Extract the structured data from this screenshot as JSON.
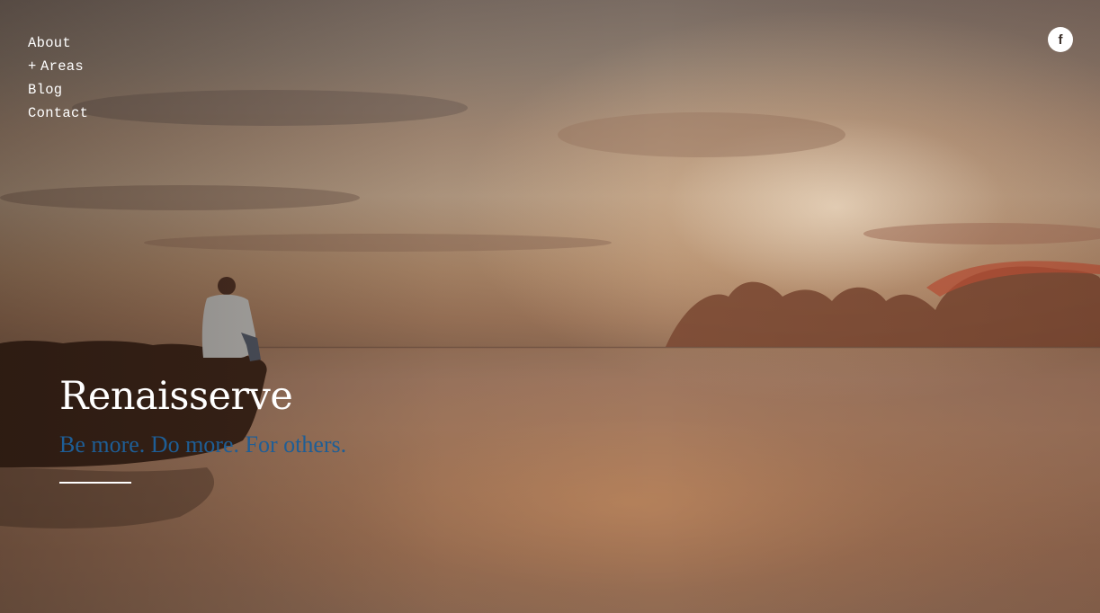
{
  "nav": {
    "items": [
      {
        "label": "About",
        "has_submenu": false
      },
      {
        "label": "Areas",
        "has_submenu": true,
        "prefix": "+"
      },
      {
        "label": "Blog",
        "has_submenu": false
      },
      {
        "label": "Contact",
        "has_submenu": false
      }
    ]
  },
  "social": {
    "icon": "facebook-icon",
    "glyph": "f"
  },
  "hero": {
    "site_title": "Renaisserve",
    "tagline": "Be more. Do more. For others."
  },
  "colors": {
    "tagline": "#1e5e96",
    "nav_text": "#ffffff",
    "title_text": "#ffffff"
  }
}
